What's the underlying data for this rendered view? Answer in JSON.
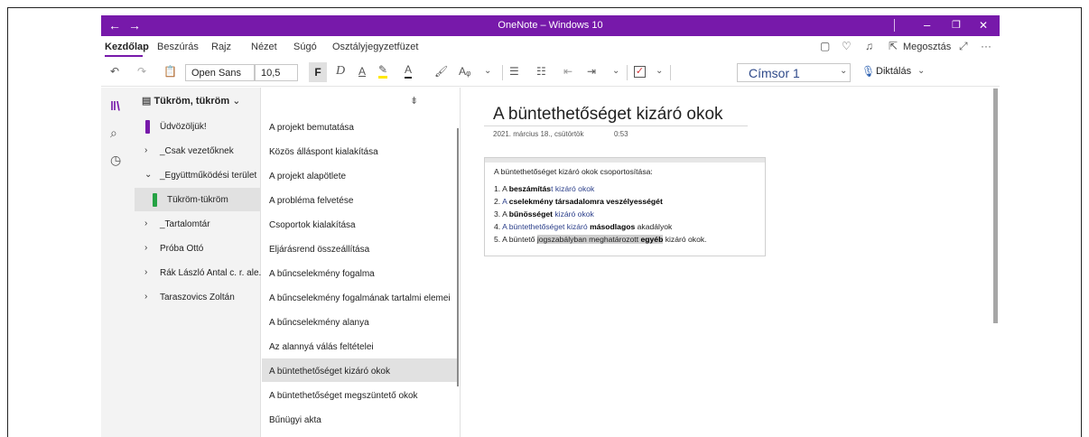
{
  "window": {
    "title": "OneNote – Windows 10",
    "back_glyph": "←",
    "forward_glyph": "→",
    "minimize_glyph": "–",
    "restore_glyph": "❐",
    "close_glyph": "✕"
  },
  "menu": {
    "items": [
      "Kezdőlap",
      "Beszúrás",
      "Rajz",
      "Nézet",
      "Súgó",
      "Osztályjegyzetfüzet"
    ],
    "share_label": "Megosztás",
    "more_glyph": "···"
  },
  "toolbar": {
    "font_name": "Open Sans",
    "font_size": "10,5",
    "bold": "F",
    "italic": "D",
    "underline": "A",
    "style": "Címsor 1",
    "dictate": "Diktálás"
  },
  "notebook": {
    "name": "Tükröm, tükröm",
    "sections": [
      {
        "label": "Üdvözöljük!",
        "type": "section",
        "color": "#7719aa"
      },
      {
        "label": "_Csak vezetőknek",
        "type": "group",
        "expanded": false
      },
      {
        "label": "_Együttműködési terület",
        "type": "group",
        "expanded": true
      },
      {
        "label": "Tükröm-tükröm",
        "type": "section",
        "color": "#25a244",
        "selected": true
      },
      {
        "label": "_Tartalomtár",
        "type": "group",
        "expanded": false
      },
      {
        "label": "Próba Ottó",
        "type": "group",
        "expanded": false
      },
      {
        "label": "Rák László Antal c. r. ale...",
        "type": "group",
        "expanded": false
      },
      {
        "label": "Taraszovics Zoltán",
        "type": "group",
        "expanded": false
      }
    ]
  },
  "pages": [
    {
      "label": "A projekt bemutatása"
    },
    {
      "label": "Közös álláspont kialakítása"
    },
    {
      "label": "A projekt alapötlete"
    },
    {
      "label": "A probléma felvetése"
    },
    {
      "label": "Csoportok kialakítása"
    },
    {
      "label": "Eljárásrend összeállítása"
    },
    {
      "label": "A bűncselekmény fogalma"
    },
    {
      "label": "A bűncselekmény fogalmának tartalmi elemei"
    },
    {
      "label": "A bűncselekmény alanya"
    },
    {
      "label": "Az alannyá válás feltételei"
    },
    {
      "label": "A büntethetőséget kizáró okok",
      "selected": true
    },
    {
      "label": "A büntethetőséget megszüntető okok"
    },
    {
      "label": "Bűnügyi akta"
    }
  ],
  "page": {
    "title": "A büntethetőséget kizáró okok",
    "date": "2021. március 18., csütörtök",
    "time": "0:53",
    "note_heading": "A büntethetőséget kizáró okok csoportosítása:",
    "items": [
      {
        "num": "1. ",
        "a": "A ",
        "b": "beszámítás",
        "c": "t kizáró okok"
      },
      {
        "num": "2. ",
        "a": "A ",
        "b": "cselekmény",
        "c": " ",
        "d": "társadalomra veszélyességét"
      },
      {
        "num": "3. ",
        "a": "A ",
        "b": "bűnösséget",
        "c": " kizáró okok"
      },
      {
        "num": "4. ",
        "a": "A büntethetőséget kizáró ",
        "b": "másodlagos",
        "c": " akadályok"
      },
      {
        "num": "5. ",
        "a": "A büntető ",
        "b": "jogszabályban meghatározott",
        "c": " ",
        "d": "egyéb",
        "e": " kizáró okok."
      }
    ]
  },
  "colors": {
    "accent": "#7719aa",
    "selected_row": "#e1e1e1",
    "pane_bg": "#f3f3f3"
  }
}
